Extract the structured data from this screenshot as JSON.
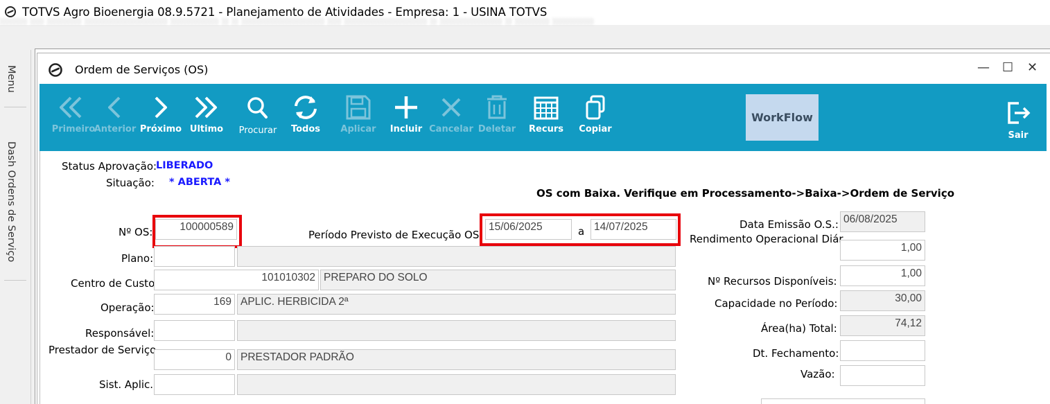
{
  "app": {
    "title": "TOTVS Agro Bioenergia 08.9.5721 - Planejamento de Atividades  - Empresa: 1 - USINA TOTVS",
    "blur_text": "░░░░ ░░ ░░░░░ ░░░░░░░░░░░░ ░░░░░░░ ░ ░ ░░░░░░░░░░░░ ░░ ░░░░░░░░░░░░ ░ ░░░░░░░░░ ░ ░░░░░ ░░░░░░"
  },
  "side_tabs": {
    "menu": "Menu",
    "dash": "Dash Ordens de Serviço"
  },
  "window": {
    "title": "Ordem de Serviços (OS)",
    "minimize": "—",
    "maximize": "☐",
    "close": "✕"
  },
  "toolbar": {
    "primeiro": "Primeiro",
    "anterior": "Anterior",
    "proximo": "Próximo",
    "ultimo": "Ultimo",
    "procurar": "Procurar",
    "todos": "Todos",
    "aplicar": "Aplicar",
    "incluir": "Incluir",
    "cancelar": "Cancelar",
    "deletar": "Deletar",
    "recurs": "Recurs",
    "copiar": "Copiar",
    "workflow": "WorkFlow",
    "sair": "Sair"
  },
  "form": {
    "status_aprovacao_label": "Status Aprovação:",
    "status_aprovacao_value": "LIBERADO",
    "situacao_label": "Situação:",
    "situacao_value": "* ABERTA *",
    "notice": "OS com Baixa. Verifique em Processamento->Baixa->Ordem de Serviço",
    "num_os_label": "Nº OS:",
    "num_os_value": "100000589",
    "periodo_label": "Período Previsto de Execução OS:",
    "periodo_inicio": "15/06/2025",
    "periodo_sep": "a",
    "periodo_fim": "14/07/2025",
    "plano_label": "Plano:",
    "plano_code": "",
    "plano_desc": "",
    "centro_custo_label": "Centro de Custo:",
    "centro_custo_code": "101010302",
    "centro_custo_desc": "PREPARO DO SOLO",
    "operacao_label": "Operação:",
    "operacao_code": "169",
    "operacao_desc": "APLIC. HERBICIDA 2ª",
    "responsavel_label": "Responsável:",
    "responsavel_code": "",
    "responsavel_desc": "",
    "prestador_label": "Prestador de Serviço",
    "prestador_code": "0",
    "prestador_desc": "PRESTADOR PADRÃO",
    "sist_aplic_label": "Sist. Aplic.:",
    "sist_aplic_code": "",
    "sist_aplic_desc": "",
    "data_emissao_label": "Data Emissão O.S.:",
    "data_emissao_value": "06/08/2025",
    "rendimento_label": "Rendimento Operacional Diár",
    "rendimento_value": "1,00",
    "recursos_label": "Nº Recursos Disponíveis:",
    "recursos_value": "1,00",
    "capacidade_label": "Capacidade no Período:",
    "capacidade_value": "30,00",
    "area_label": "Área(ha) Total:",
    "area_value": "74,12",
    "dt_fechamento_label": "Dt. Fechamento:",
    "dt_fechamento_value": "",
    "vazao_label": "Vazão:",
    "vazao_value": ""
  },
  "colors": {
    "toolbar_bg": "#129bc3",
    "highlight": "#e8000b",
    "status_blue": "#1a1aff",
    "workflow_bg": "#c5d9ee"
  }
}
